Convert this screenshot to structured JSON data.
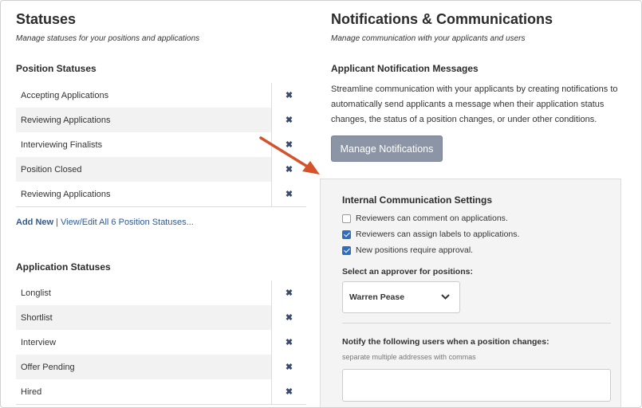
{
  "statuses": {
    "title": "Statuses",
    "subtitle": "Manage statuses for your positions and applications",
    "position": {
      "heading": "Position Statuses",
      "items": [
        "Accepting Applications",
        "Reviewing Applications",
        "Interviewing Finalists",
        "Position Closed",
        "Reviewing Applications"
      ],
      "delete_glyph": "✖",
      "add_new": "Add New",
      "separator": "|",
      "view_edit": "View/Edit All 6 Position Statuses..."
    },
    "application": {
      "heading": "Application Statuses",
      "items": [
        "Longlist",
        "Shortlist",
        "Interview",
        "Offer Pending",
        "Hired"
      ],
      "delete_glyph": "✖"
    }
  },
  "notifications": {
    "title": "Notifications & Communications",
    "subtitle": "Manage communication with your applicants and users",
    "applicant_heading": "Applicant Notification Messages",
    "applicant_paragraph": "Streamline communication with your applicants by creating notifications to automatically send applicants a message when their application status changes, the status of a position changes, or under other conditions.",
    "manage_button": "Manage Notifications",
    "internal": {
      "heading": "Internal Communication Settings",
      "options": [
        {
          "label": "Reviewers can comment on applications.",
          "checked": false
        },
        {
          "label": "Reviewers can assign labels to applications.",
          "checked": true
        },
        {
          "label": "New positions require approval.",
          "checked": true
        }
      ],
      "approver_label": "Select an approver for positions:",
      "approver_value": "Warren Pease",
      "notify_label": "Notify the following users when a position changes:",
      "notify_hint": "separate multiple addresses with commas",
      "notify_value": ""
    }
  },
  "colors": {
    "accent_link": "#2e5a96",
    "button_gray": "#8c95a6",
    "checkbox_blue": "#2f6dbf",
    "arrow_orange": "#d4532b"
  }
}
